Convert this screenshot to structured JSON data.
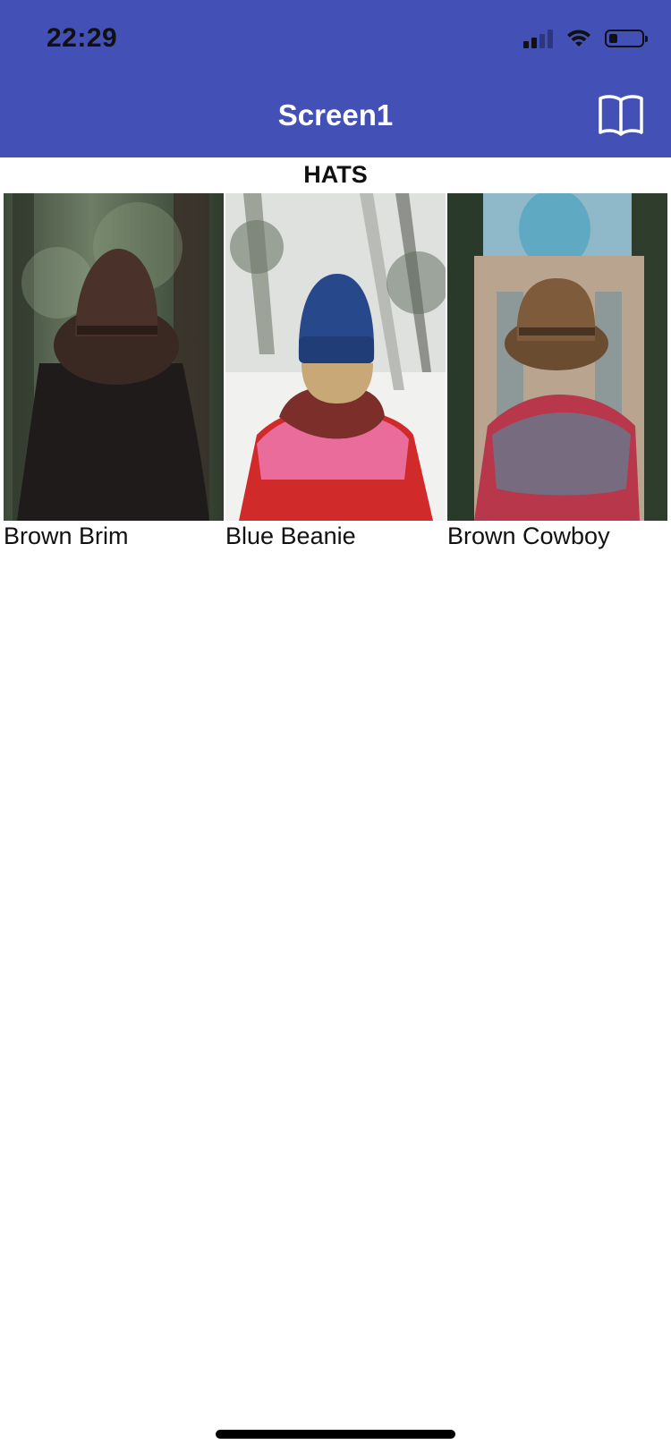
{
  "status_bar": {
    "time": "22:29",
    "battery_level": 0.25,
    "signal_bars": 2
  },
  "header": {
    "title": "Screen1",
    "action_icon": "book-icon",
    "background_color": "#4350b5"
  },
  "section": {
    "title": "HATS"
  },
  "items": [
    {
      "label": "Brown Brim",
      "image": "woman-brown-fedora-forest"
    },
    {
      "label": "Blue Beanie",
      "image": "person-blue-beanie-snow"
    },
    {
      "label": "Brown Cowboy",
      "image": "woman-brown-cowboy-hat-scarf"
    }
  ]
}
